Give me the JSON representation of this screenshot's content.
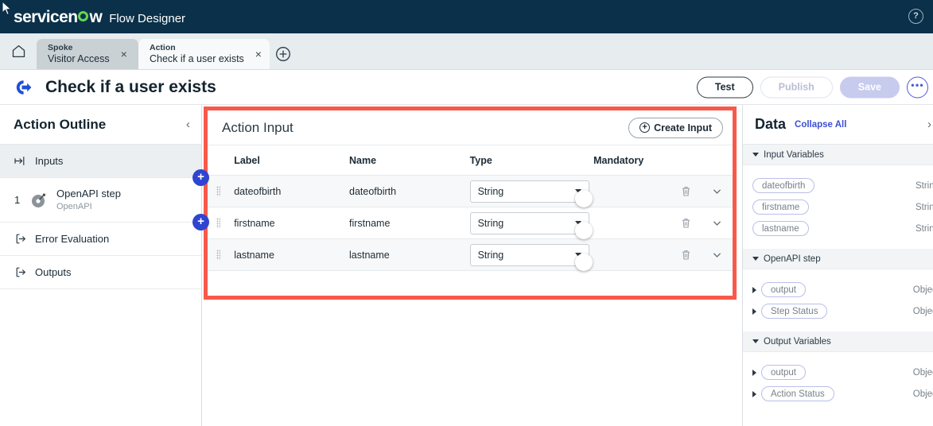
{
  "topbar": {
    "logo_pre": "servicen",
    "logo_post": "w",
    "app_name": "Flow Designer",
    "help_icon": "?"
  },
  "tabstrip": {
    "home_icon": "home-icon",
    "new_tab_icon": "plus-circle-icon",
    "tabs": [
      {
        "kind": "Spoke",
        "title": "Visitor Access",
        "active": false,
        "close": "×"
      },
      {
        "kind": "Action",
        "title": "Check if a user exists",
        "active": true,
        "close": "×"
      }
    ]
  },
  "title_row": {
    "icon": "action-arrow-icon",
    "title": "Check if a user exists",
    "buttons": {
      "test": "Test",
      "publish": "Publish",
      "save": "Save",
      "more": "•••"
    }
  },
  "sidebar": {
    "title": "Action Outline",
    "collapse_icon": "‹",
    "items": [
      {
        "label": "Inputs",
        "icon": "enter-arrow-icon",
        "selected": true
      },
      {
        "label": "OpenAPI step",
        "sub": "OpenAPI",
        "num": "1",
        "icon": "openapi-icon",
        "selected": false
      },
      {
        "label": "Error Evaluation",
        "icon": "exit-arrow-icon",
        "selected": false
      },
      {
        "label": "Outputs",
        "icon": "exit-arrow-icon",
        "selected": false
      }
    ],
    "add_button": "+"
  },
  "action_input": {
    "panel_title": "Action Input",
    "create_button": "Create Input",
    "create_icon": "+",
    "columns": [
      "Label",
      "Name",
      "Type",
      "Mandatory"
    ],
    "rows": [
      {
        "label": "dateofbirth",
        "name": "dateofbirth",
        "type": "String",
        "mandatory": true
      },
      {
        "label": "firstname",
        "name": "firstname",
        "type": "String",
        "mandatory": true
      },
      {
        "label": "lastname",
        "name": "lastname",
        "type": "String",
        "mandatory": true
      }
    ],
    "delete_icon": "delete-icon",
    "expand_icon": "chevron-down-icon",
    "highlight_color": "#f9594a"
  },
  "data_panel": {
    "title": "Data",
    "collapse_all": "Collapse All",
    "expand_icon": "›",
    "groups": [
      {
        "name": "Input Variables",
        "vars": [
          {
            "label": "dateofbirth",
            "type": "String",
            "expandable": false
          },
          {
            "label": "firstname",
            "type": "String",
            "expandable": false
          },
          {
            "label": "lastname",
            "type": "String",
            "expandable": false
          }
        ]
      },
      {
        "name": "OpenAPI step",
        "vars": [
          {
            "label": "output",
            "type": "Object",
            "expandable": true
          },
          {
            "label": "Step Status",
            "type": "Object",
            "expandable": true
          }
        ]
      },
      {
        "name": "Output Variables",
        "vars": [
          {
            "label": "output",
            "type": "Object",
            "expandable": true
          },
          {
            "label": "Action Status",
            "type": "Object",
            "expandable": true
          }
        ]
      }
    ]
  }
}
